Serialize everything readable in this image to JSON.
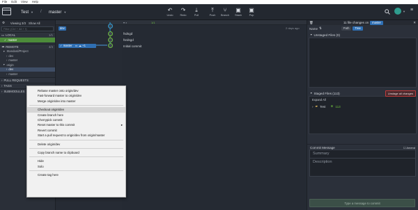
{
  "menubar": [
    "File",
    "Edit",
    "View",
    "Help"
  ],
  "toolbar": {
    "repo_name": "Test",
    "branch_name": "master",
    "buttons": [
      {
        "id": "undo",
        "label": "Undo",
        "icon": "↶"
      },
      {
        "id": "redo",
        "label": "Redo",
        "icon": "↷"
      },
      {
        "id": "pull",
        "label": "Pull",
        "icon": "⤓"
      },
      {
        "id": "push",
        "label": "Push",
        "icon": "⤒"
      },
      {
        "id": "branch",
        "label": "Branch",
        "icon": "⑂"
      },
      {
        "id": "stash",
        "label": "Stash",
        "icon": "▣"
      },
      {
        "id": "pop",
        "label": "Pop",
        "icon": "▣"
      }
    ]
  },
  "left_panel": {
    "viewing_label": "Viewing 3/3",
    "show_all": "Show All",
    "filter_placeholder": "Filter (Ctrl + Alt + f)",
    "local": {
      "label": "LOCAL",
      "count": "1/1",
      "branches": [
        "master"
      ]
    },
    "remote": {
      "label": "REMOTE",
      "count": "4/4"
    },
    "remotes": [
      "Standard/Project",
      "dev",
      "master",
      "origin",
      "dev",
      "master"
    ],
    "sections": [
      "PULL REQUESTS",
      "TAGS",
      "SUBMODULES"
    ]
  },
  "graph": {
    "header_count": "1/1",
    "rows": [
      {
        "message": "",
        "badge": "dev",
        "time": "2 days ago"
      },
      {
        "message": "fsdsgd",
        "badge": "",
        "time": ""
      },
      {
        "message": "fsrdsgd",
        "badge": "",
        "time": ""
      },
      {
        "message": "Initial commit",
        "badge": "master",
        "time": ""
      }
    ],
    "master_badge_extra": "+1"
  },
  "context_menu": {
    "items": [
      {
        "label": "Rebase master onto origin/dev",
        "sep_after": false
      },
      {
        "label": "Fast-forward master to origin/dev",
        "sep_after": false
      },
      {
        "label": "Merge origin/dev into master",
        "sep_after": true
      },
      {
        "label": "Checkout origin/dev",
        "sep_after": false,
        "highlight": true
      },
      {
        "label": "Create branch here",
        "sep_after": false
      },
      {
        "label": "Cherrypick commit",
        "sep_after": false
      },
      {
        "label": "Reset master to this commit",
        "sep_after": false,
        "submenu": true
      },
      {
        "label": "Revert commit",
        "sep_after": false
      },
      {
        "label": "Start a pull request to origin/dev from origin/master",
        "sep_after": true
      },
      {
        "label": "Delete origin/dev",
        "sep_after": true
      },
      {
        "label": "Copy branch name to clipboard",
        "sep_after": true
      },
      {
        "label": "Hide",
        "sep_after": false
      },
      {
        "label": "Solo",
        "sep_after": true
      },
      {
        "label": "Create tag here",
        "sep_after": false
      }
    ]
  },
  "right_panel": {
    "changes_label": "11 file changes on",
    "branch": "master",
    "name_label": "Name",
    "path_label": "Path",
    "tree_label": "Tree",
    "unstaged": "Unstaged Files (0)",
    "staged": "Staged Files (113)",
    "unstage_all": "Unstage all changes",
    "expand_all": "Expand All",
    "staged_folder": "Test",
    "staged_count": "113",
    "commit_message_label": "Commit Message",
    "amend_label": "Amend",
    "summary_placeholder": "Summary",
    "description_placeholder": "Description",
    "submit_label": "Type a message to commit"
  },
  "colors": {
    "accent_green": "#6fbf3f",
    "badge_blue": "#2f6fb3",
    "danger": "#c13a3a"
  }
}
